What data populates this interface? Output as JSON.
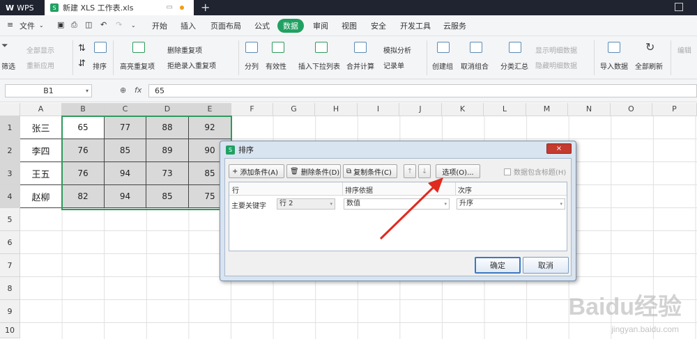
{
  "titlebar": {
    "app": "WPS",
    "doc_title": "新建 XLS 工作表.xls"
  },
  "menubar": {
    "file": "文件",
    "items": [
      "开始",
      "插入",
      "页面布局",
      "公式",
      "数据",
      "审阅",
      "视图",
      "安全",
      "开发工具",
      "云服务"
    ],
    "active": "数据"
  },
  "ribbon": {
    "filter": "筛选",
    "show_all": "全部显示",
    "reapply": "重新应用",
    "sort": "排序",
    "highlight_dup": "高亮重复项",
    "remove_dup": "删除重复项",
    "reject_dup": "拒绝录入重复项",
    "split": "分列",
    "validity": "有效性",
    "insert_dropdown": "插入下拉列表",
    "merge_calc": "合并计算",
    "simulation": "模拟分析",
    "record": "记录单",
    "create_group": "创建组",
    "ungroup": "取消组合",
    "subtotal": "分类汇总",
    "show_detail": "显示明细数据",
    "hide_detail": "隐藏明细数据",
    "import": "导入数据",
    "refresh_all": "全部刷新",
    "edit": "编辑"
  },
  "formula": {
    "namebox": "B1",
    "fx": "fx",
    "value": "65"
  },
  "columns": [
    "A",
    "B",
    "C",
    "D",
    "E",
    "F",
    "G",
    "H",
    "I",
    "J",
    "K",
    "L",
    "M",
    "N",
    "O",
    "P"
  ],
  "rows": [
    "1",
    "2",
    "3",
    "4",
    "5",
    "6",
    "7",
    "8",
    "9",
    "10"
  ],
  "cells": [
    [
      "张三",
      "65",
      "77",
      "88",
      "92"
    ],
    [
      "李四",
      "76",
      "85",
      "89",
      "90"
    ],
    [
      "王五",
      "76",
      "94",
      "73",
      "85"
    ],
    [
      "赵柳",
      "82",
      "94",
      "85",
      "75"
    ]
  ],
  "dialog": {
    "title": "排序",
    "close": "×",
    "add": "添加条件(A)",
    "delete": "删除条件(D)",
    "copy": "复制条件(C)",
    "up": "↑",
    "down": "↓",
    "options": "选项(O)...",
    "header_check": "数据包含标题(H)",
    "col_row": "行",
    "col_basis": "排序依据",
    "col_order": "次序",
    "primary_key": "主要关键字",
    "key_value": "行 2",
    "basis_value": "数值",
    "order_value": "升序",
    "ok": "确定",
    "cancel": "取消"
  },
  "watermark": {
    "main": "Baidu经验",
    "sub": "jingyan.baidu.com"
  },
  "colors": {
    "accent": "#20a162",
    "selection": "#2c9a5b",
    "arrow": "#e02a1e"
  }
}
